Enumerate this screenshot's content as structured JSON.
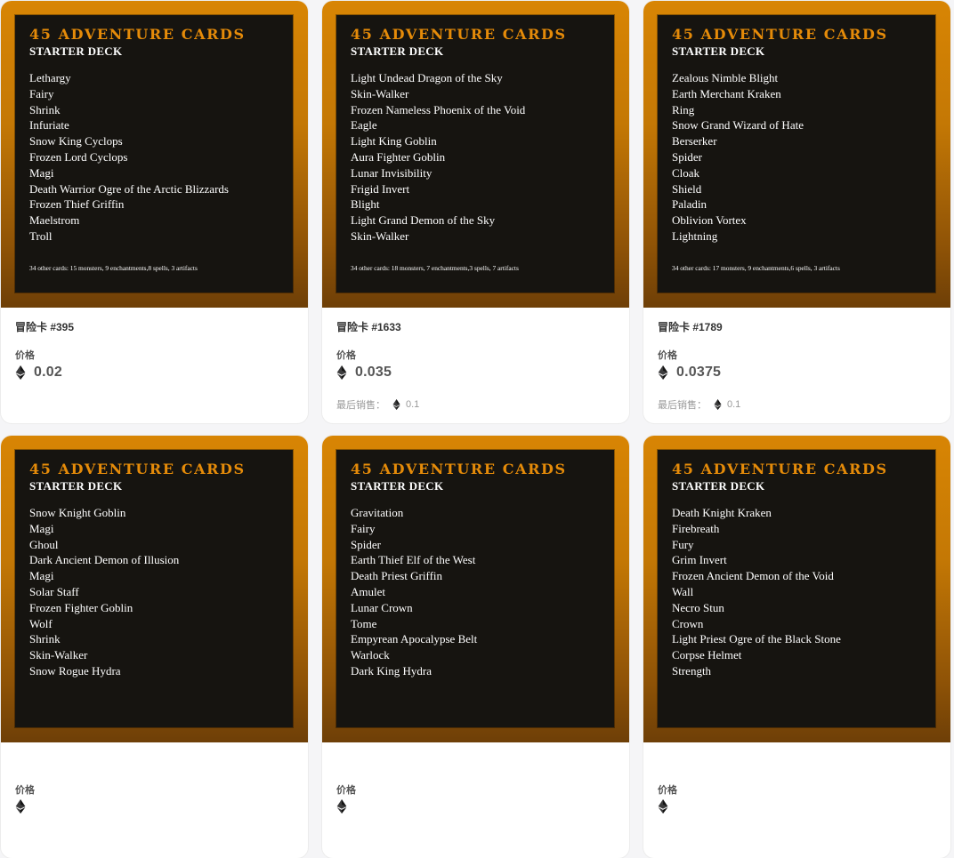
{
  "colors": {
    "accent_title": "#e58b09",
    "frame_top": "#d88504",
    "frame_bottom": "#6e3f07",
    "panel": "#161410",
    "page_bg": "#f5f5f7"
  },
  "labels": {
    "price": "价格",
    "last_sale": "最后销售：",
    "currency_icon": "ethereum-icon"
  },
  "cards": [
    {
      "title": "45 Adventure Cards",
      "subtitle": "STARTER DECK",
      "items": [
        "Lethargy",
        "Fairy",
        "Shrink",
        "Infuriate",
        "Snow King Cyclops",
        "Frozen Lord Cyclops",
        "Magi",
        "Death Warrior Ogre of the Arctic Blizzards",
        "Frozen Thief Griffin",
        "Maelstrom",
        "Troll"
      ],
      "other": "34 other cards: 15 monsters, 9 enchantments,8 spells, 3 artifacts",
      "name": "冒险卡 #395",
      "price": "0.02",
      "last_sale": ""
    },
    {
      "title": "45 Adventure Cards",
      "subtitle": "STARTER DECK",
      "items": [
        "Light Undead Dragon of the Sky",
        "Skin-Walker",
        "Frozen Nameless Phoenix of the Void",
        "Eagle",
        "Light King Goblin",
        "Aura Fighter Goblin",
        "Lunar Invisibility",
        "Frigid Invert",
        "Blight",
        "Light Grand Demon of the Sky",
        "Skin-Walker"
      ],
      "other": "34 other cards: 18 monsters, 7 enchantments,3 spells, 7 artifacts",
      "name": "冒险卡 #1633",
      "price": "0.035",
      "last_sale": "0.1"
    },
    {
      "title": "45 Adventure Cards",
      "subtitle": "STARTER DECK",
      "items": [
        "Zealous Nimble Blight",
        "Earth Merchant Kraken",
        "Ring",
        "Snow Grand Wizard of Hate",
        "Berserker",
        "Spider",
        "Cloak",
        "Shield",
        "Paladin",
        "Oblivion Vortex",
        "Lightning"
      ],
      "other": "34 other cards: 17 monsters, 9 enchantments,6 spells, 3 artifacts",
      "name": "冒险卡 #1789",
      "price": "0.0375",
      "last_sale": "0.1"
    },
    {
      "title": "45 Adventure Cards",
      "subtitle": "STARTER DECK",
      "items": [
        "Snow Knight Goblin",
        "Magi",
        "Ghoul",
        "Dark Ancient Demon of Illusion",
        "Magi",
        "Solar Staff",
        "Frozen Fighter Goblin",
        "Wolf",
        "Shrink",
        "Skin-Walker",
        "Snow Rogue Hydra"
      ],
      "other": "",
      "name": "",
      "price": "",
      "last_sale": ""
    },
    {
      "title": "45 Adventure Cards",
      "subtitle": "STARTER DECK",
      "items": [
        "Gravitation",
        "Fairy",
        "Spider",
        "Earth Thief Elf of the West",
        "Death Priest Griffin",
        "Amulet",
        "Lunar Crown",
        "Tome",
        "Empyrean Apocalypse Belt",
        "Warlock",
        "Dark King Hydra"
      ],
      "other": "",
      "name": "",
      "price": "",
      "last_sale": ""
    },
    {
      "title": "45 Adventure Cards",
      "subtitle": "STARTER DECK",
      "items": [
        "Death Knight Kraken",
        "Firebreath",
        "Fury",
        "Grim Invert",
        "Frozen Ancient Demon of the Void",
        "Wall",
        "Necro Stun",
        "Crown",
        "Light Priest Ogre of the Black Stone",
        "Corpse Helmet",
        "Strength"
      ],
      "other": "",
      "name": "",
      "price": "",
      "last_sale": ""
    }
  ]
}
